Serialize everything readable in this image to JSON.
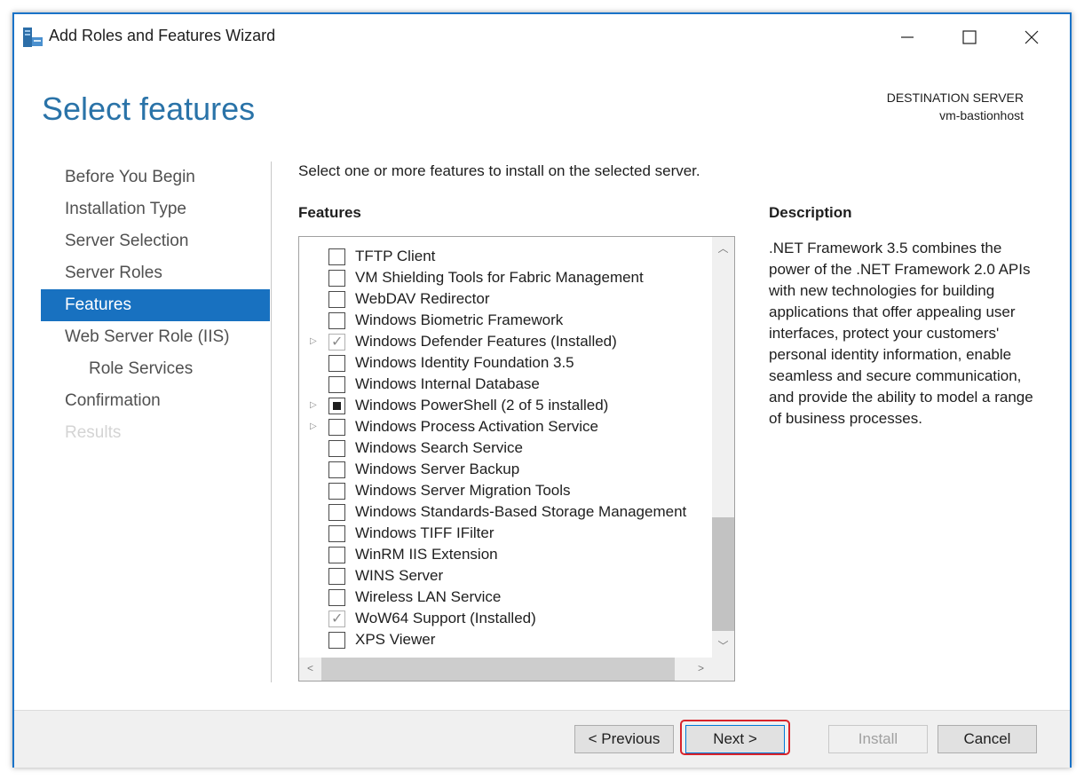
{
  "window": {
    "title": "Add Roles and Features Wizard",
    "controls": [
      "minimize-icon",
      "maximize-icon",
      "close-icon"
    ]
  },
  "header": {
    "page_title": "Select features",
    "destination_label": "DESTINATION SERVER",
    "destination_value": "vm-bastionhost"
  },
  "nav": {
    "items": [
      {
        "label": "Before You Begin",
        "state": "normal"
      },
      {
        "label": "Installation Type",
        "state": "normal"
      },
      {
        "label": "Server Selection",
        "state": "normal"
      },
      {
        "label": "Server Roles",
        "state": "normal"
      },
      {
        "label": "Features",
        "state": "active"
      },
      {
        "label": "Web Server Role (IIS)",
        "state": "normal"
      },
      {
        "label": "Role Services",
        "state": "sub"
      },
      {
        "label": "Confirmation",
        "state": "normal"
      },
      {
        "label": "Results",
        "state": "disabled"
      }
    ]
  },
  "main": {
    "instruction": "Select one or more features to install on the selected server.",
    "features_label": "Features",
    "features": [
      {
        "label": "TFTP Client",
        "state": "unchecked",
        "expandable": false
      },
      {
        "label": "VM Shielding Tools for Fabric Management",
        "state": "unchecked",
        "expandable": false
      },
      {
        "label": "WebDAV Redirector",
        "state": "unchecked",
        "expandable": false
      },
      {
        "label": "Windows Biometric Framework",
        "state": "unchecked",
        "expandable": false
      },
      {
        "label": "Windows Defender Features (Installed)",
        "state": "checked",
        "expandable": true
      },
      {
        "label": "Windows Identity Foundation 3.5",
        "state": "unchecked",
        "expandable": false
      },
      {
        "label": "Windows Internal Database",
        "state": "unchecked",
        "expandable": false
      },
      {
        "label": "Windows PowerShell (2 of 5 installed)",
        "state": "partial",
        "expandable": true
      },
      {
        "label": "Windows Process Activation Service",
        "state": "unchecked",
        "expandable": true
      },
      {
        "label": "Windows Search Service",
        "state": "unchecked",
        "expandable": false
      },
      {
        "label": "Windows Server Backup",
        "state": "unchecked",
        "expandable": false
      },
      {
        "label": "Windows Server Migration Tools",
        "state": "unchecked",
        "expandable": false
      },
      {
        "label": "Windows Standards-Based Storage Management",
        "state": "unchecked",
        "expandable": false
      },
      {
        "label": "Windows TIFF IFilter",
        "state": "unchecked",
        "expandable": false
      },
      {
        "label": "WinRM IIS Extension",
        "state": "unchecked",
        "expandable": false
      },
      {
        "label": "WINS Server",
        "state": "unchecked",
        "expandable": false
      },
      {
        "label": "Wireless LAN Service",
        "state": "unchecked",
        "expandable": false
      },
      {
        "label": "WoW64 Support (Installed)",
        "state": "checked",
        "expandable": false
      },
      {
        "label": "XPS Viewer",
        "state": "unchecked",
        "expandable": false
      }
    ],
    "description_label": "Description",
    "description_text": ".NET Framework 3.5 combines the power of the .NET Framework 2.0 APIs with new technologies for building applications that offer appealing user interfaces, protect your customers' personal identity information, enable seamless and secure communication, and provide the ability to model a range of business processes."
  },
  "footer": {
    "previous_label": "< Previous",
    "next_label": "Next >",
    "install_label": "Install",
    "cancel_label": "Cancel"
  },
  "colors": {
    "accent": "#1871c0",
    "title_blue": "#2a73a8",
    "highlight_red": "#d8232a"
  }
}
